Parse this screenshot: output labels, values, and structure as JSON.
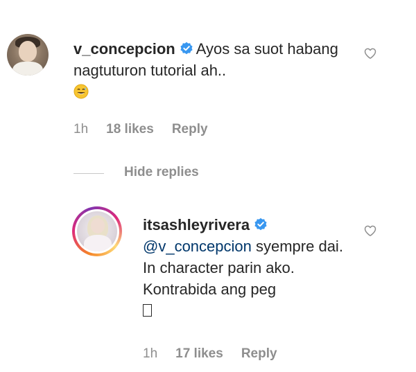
{
  "comment": {
    "username": "v_concepcion",
    "text": "Ayos sa suot habang nagtuturon tutorial ah..",
    "emoji": "grinning-sweat-emoji",
    "time": "1h",
    "likes": "18 likes",
    "reply_label": "Reply"
  },
  "hide_replies_label": "Hide replies",
  "reply": {
    "username": "itsashleyrivera",
    "mention": "@v_concepcion",
    "text": " syempre dai. In character parin ako. Kontrabida ang peg",
    "time": "1h",
    "likes": "17 likes",
    "reply_label": "Reply"
  },
  "colors": {
    "text": "#262626",
    "meta": "#8e8e8e",
    "mention": "#00376b",
    "verified": "#3897f0"
  },
  "icons": [
    "verified-badge-icon",
    "heart-outline-icon",
    "emoji-icon"
  ]
}
